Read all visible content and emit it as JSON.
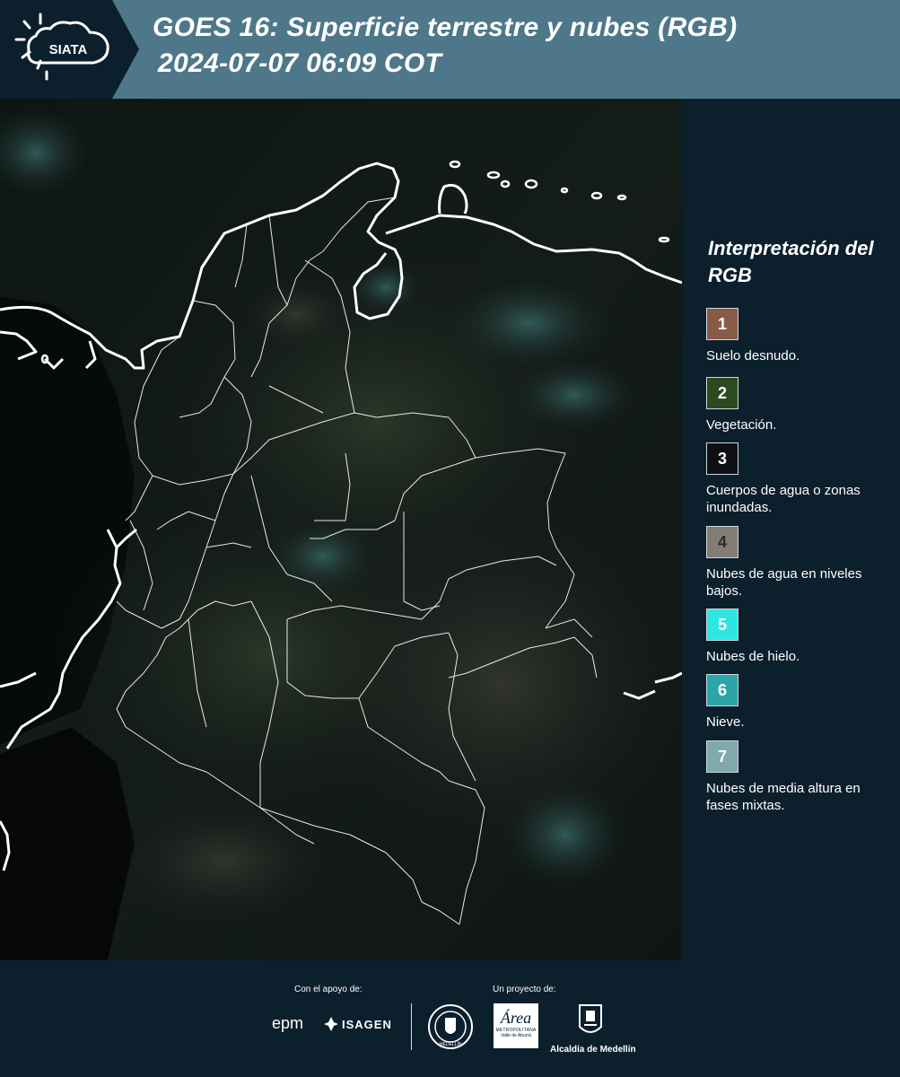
{
  "header": {
    "logo_text": "SIATA",
    "title_line1": "GOES 16: Superficie terrestre y nubes (RGB)",
    "title_line2": "2024-07-07 06:09 COT"
  },
  "map": {
    "image_type": "satellite-rgb-composite",
    "country": "Colombia",
    "border_color": "#ffffff",
    "background_color": "#0a0e0e"
  },
  "legend": {
    "title": "Interpretación del RGB",
    "items": [
      {
        "number": "1",
        "label": "Suelo desnudo.",
        "color": "#8a5a48"
      },
      {
        "number": "2",
        "label": "Vegetación.",
        "color": "#2c4a22"
      },
      {
        "number": "3",
        "label": "Cuerpos de agua o zonas inundadas.",
        "color": "#0e1013"
      },
      {
        "number": "4",
        "label": "Nubes de agua en niveles bajos.",
        "color": "#847d74"
      },
      {
        "number": "5",
        "label": "Nubes de hielo.",
        "color": "#2ee6e0"
      },
      {
        "number": "6",
        "label": "Nieve.",
        "color": "#2aa6a8"
      },
      {
        "number": "7",
        "label": "Nubes de media altura en fases mixtas.",
        "color": "#7fa9ad"
      }
    ]
  },
  "footer": {
    "support_caption": "Con el apoyo de:",
    "project_caption": "Un proyecto de:",
    "sponsors": [
      "epm",
      "ISAGEN"
    ],
    "project_logos": [
      "Área Metropolitana Valle de Aburrá",
      "Alcaldía de Medellín"
    ],
    "epm_text": "epm",
    "isagen_text": "ISAGEN",
    "area_text": "Área",
    "area_subtext": "METROPOLITANA",
    "area_subtext2": "Valle de Aburrá",
    "alcaldia_text": "Alcaldía de Medellín",
    "seal_text": "MEDELLÍN"
  }
}
